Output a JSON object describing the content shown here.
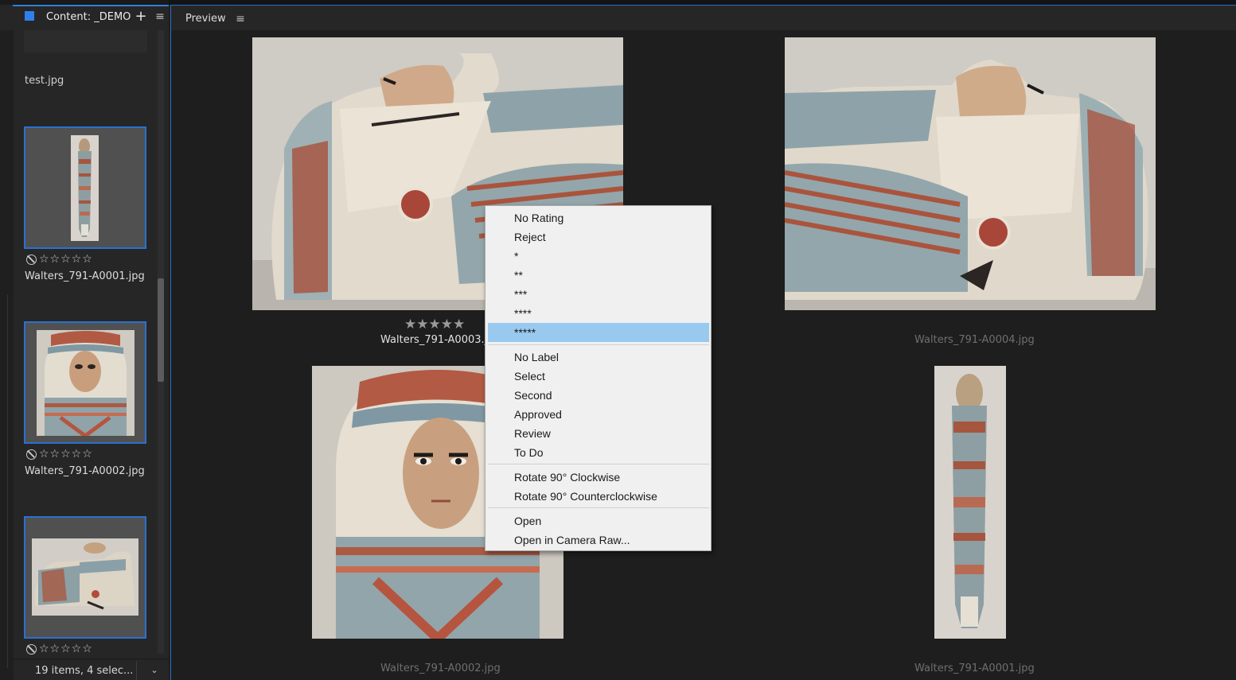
{
  "content_panel": {
    "tab_label": "Content: _DEMO",
    "add_label": "+",
    "menu_label": "≡",
    "prev_item_label": "test.jpg",
    "items": [
      {
        "filename": "Walters_791-A0001.jpg",
        "stars": "☆☆☆☆☆"
      },
      {
        "filename": "Walters_791-A0002.jpg",
        "stars": "☆☆☆☆☆"
      },
      {
        "filename": "",
        "stars": "☆☆☆☆☆"
      }
    ],
    "status": "19 items, 4 selec...",
    "status_dropdown": "⌄"
  },
  "preview_panel": {
    "title": "Preview",
    "menu_label": "≡",
    "rated_stars": "★★★★★",
    "images": [
      {
        "caption": "Walters_791-A0003.jpg"
      },
      {
        "caption": "Walters_791-A0004.jpg"
      },
      {
        "caption": "Walters_791-A0002.jpg"
      },
      {
        "caption": "Walters_791-A0001.jpg"
      }
    ]
  },
  "context_menu": {
    "items": [
      "No Rating",
      "Reject",
      "*",
      "**",
      "***",
      "****",
      "*****",
      "No Label",
      "Select",
      "Second",
      "Approved",
      "Review",
      "To Do",
      "Rotate 90° Clockwise",
      "Rotate 90° Counterclockwise",
      "Open",
      "Open in Camera Raw..."
    ],
    "highlighted": "*****"
  },
  "colors": {
    "accent": "#2f80ed",
    "selection_border": "#2a71d0",
    "menu_highlight": "#99c9ef"
  }
}
